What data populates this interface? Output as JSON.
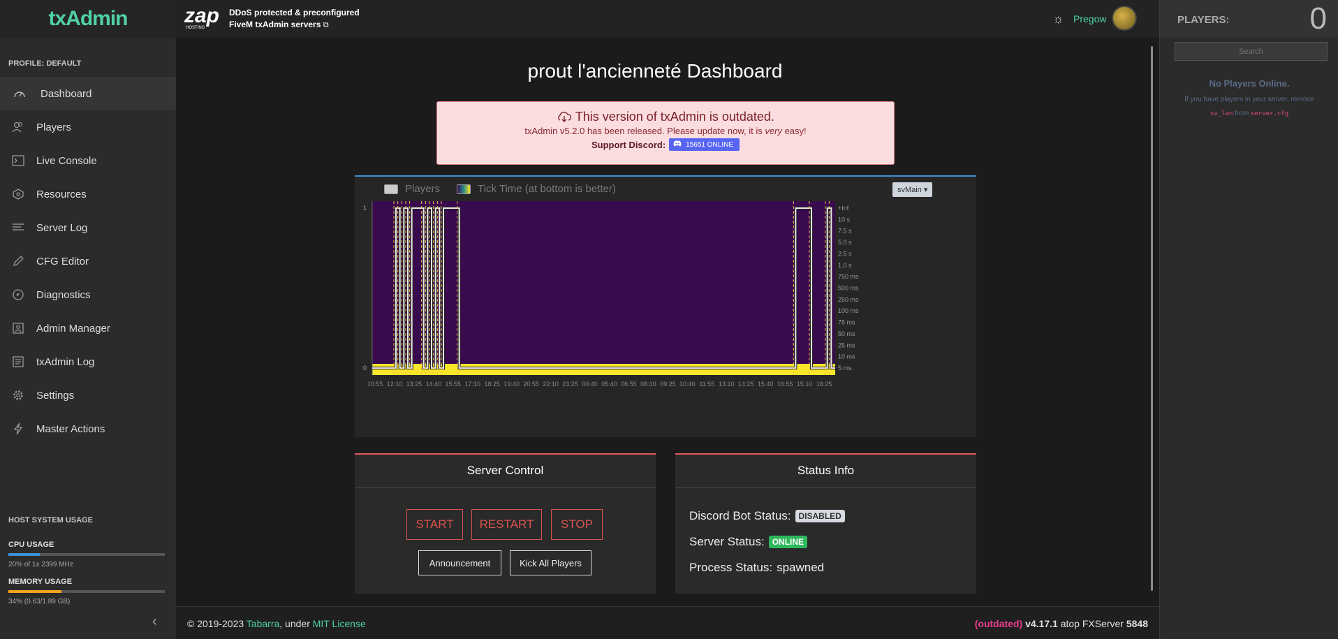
{
  "sidebar": {
    "brand": "txAdmin",
    "profile": "PROFILE: DEFAULT",
    "items": [
      {
        "label": "Dashboard",
        "icon": "speedometer-icon"
      },
      {
        "label": "Players",
        "icon": "users-icon"
      },
      {
        "label": "Live Console",
        "icon": "terminal-icon"
      },
      {
        "label": "Resources",
        "icon": "puzzle-icon"
      },
      {
        "label": "Server Log",
        "icon": "list-icon"
      },
      {
        "label": "CFG Editor",
        "icon": "pencil-icon"
      },
      {
        "label": "Diagnostics",
        "icon": "compass-icon"
      },
      {
        "label": "Admin Manager",
        "icon": "contacts-icon"
      },
      {
        "label": "txAdmin Log",
        "icon": "log-icon"
      },
      {
        "label": "Settings",
        "icon": "gear-icon"
      },
      {
        "label": "Master Actions",
        "icon": "bolt-icon"
      }
    ],
    "usage": {
      "title": "HOST SYSTEM USAGE",
      "cpu_label": "CPU USAGE",
      "cpu_percent": 20,
      "cpu_detail": "20% of 1x 2399 MHz",
      "mem_label": "MEMORY USAGE",
      "mem_percent": 34,
      "mem_detail": "34% (0.63/1.89 GB)"
    }
  },
  "header": {
    "logo_text": "zap",
    "logo_sub": "HOSTING",
    "promo_line1": "DDoS protected & preconfigured",
    "promo_line2": "FiveM txAdmin servers",
    "username": "Pregow"
  },
  "main": {
    "title": "prout l'ancienneté Dashboard",
    "alert": {
      "title": "This version of txAdmin is outdated.",
      "line_before": "txAdmin v5.2.0 has been released. Please update now, it is",
      "line_em": "very",
      "line_after": "easy!",
      "support_label": "Support Discord:",
      "discord_online": "15651 ONLINE"
    }
  },
  "chart_data": {
    "type": "heatmap",
    "legend": [
      "Players",
      "Tick Time (at bottom is better)"
    ],
    "thread_select": "svMain",
    "x_ticks": [
      "10:55",
      "12:10",
      "13:25",
      "14:40",
      "15:55",
      "17:10",
      "18:25",
      "19:40",
      "20:55",
      "22:10",
      "23:25",
      "00:40",
      "05:40",
      "06:55",
      "08:10",
      "09:25",
      "10:40",
      "11:55",
      "13:10",
      "14:25",
      "15:40",
      "16:55",
      "15:10",
      "16:25"
    ],
    "y_left_ticks": [
      "1",
      "0"
    ],
    "y_right_ticks": [
      "+Inf",
      "10 s",
      "7.5 s",
      "5.0 s",
      "2.5 s",
      "1.0 s",
      "750 ms",
      "500 ms",
      "250 ms",
      "100 ms",
      "75 ms",
      "50 ms",
      "25 ms",
      "10 ms",
      "5 ms"
    ],
    "players_line": [
      0,
      0,
      0,
      0,
      0,
      0,
      1,
      0,
      1,
      0,
      1,
      1,
      1,
      0,
      1,
      0,
      1,
      0,
      1,
      1,
      1,
      1,
      0,
      0,
      0,
      0,
      0,
      0,
      0,
      0,
      0,
      0,
      0,
      0,
      0,
      0,
      0,
      0,
      0,
      0,
      0,
      0,
      0,
      0,
      0,
      0,
      0,
      0,
      0,
      0,
      0,
      0,
      0,
      0,
      0,
      0,
      0,
      0,
      0,
      0,
      0,
      0,
      0,
      0,
      0,
      0,
      0,
      0,
      0,
      0,
      0,
      0,
      0,
      0,
      0,
      0,
      0,
      0,
      0,
      0,
      0,
      0,
      0,
      0,
      0,
      0,
      0,
      0,
      0,
      0,
      0,
      0,
      0,
      0,
      0,
      0,
      0,
      0,
      0,
      0,
      0,
      0,
      0,
      0,
      0,
      0,
      0,
      1,
      1,
      1,
      1,
      0,
      0,
      0,
      0,
      1,
      0
    ]
  },
  "server_control": {
    "title": "Server Control",
    "start": "START",
    "restart": "RESTART",
    "stop": "STOP",
    "announcement": "Announcement",
    "kick_all": "Kick All Players"
  },
  "status_info": {
    "title": "Status Info",
    "discord_label": "Discord Bot Status:",
    "discord_value": "DISABLED",
    "server_label": "Server Status:",
    "server_value": "ONLINE",
    "process_label": "Process Status:",
    "process_value": "spawned"
  },
  "footer": {
    "copyright": "© 2019-2023",
    "author": "Tabarra",
    "under": ", under",
    "license": "MIT License",
    "outdated": "(outdated)",
    "version": "v4.17.1",
    "atop": "atop FXServer",
    "build": "5848"
  },
  "players_panel": {
    "label": "PLAYERS:",
    "count": "0",
    "search_placeholder": "Search",
    "empty": "No Players Online.",
    "hint_pre": "If you have players in your server, remove",
    "hint_code1": "sv_lan",
    "hint_from": "from",
    "hint_code2": "server.cfg"
  },
  "colors": {
    "accent": "#4fd1a5",
    "danger": "#d9534f",
    "heat_bg": "#3a0a4f",
    "heat_low": "#f9e52a",
    "chart_top_border": "#3f8fd6"
  }
}
